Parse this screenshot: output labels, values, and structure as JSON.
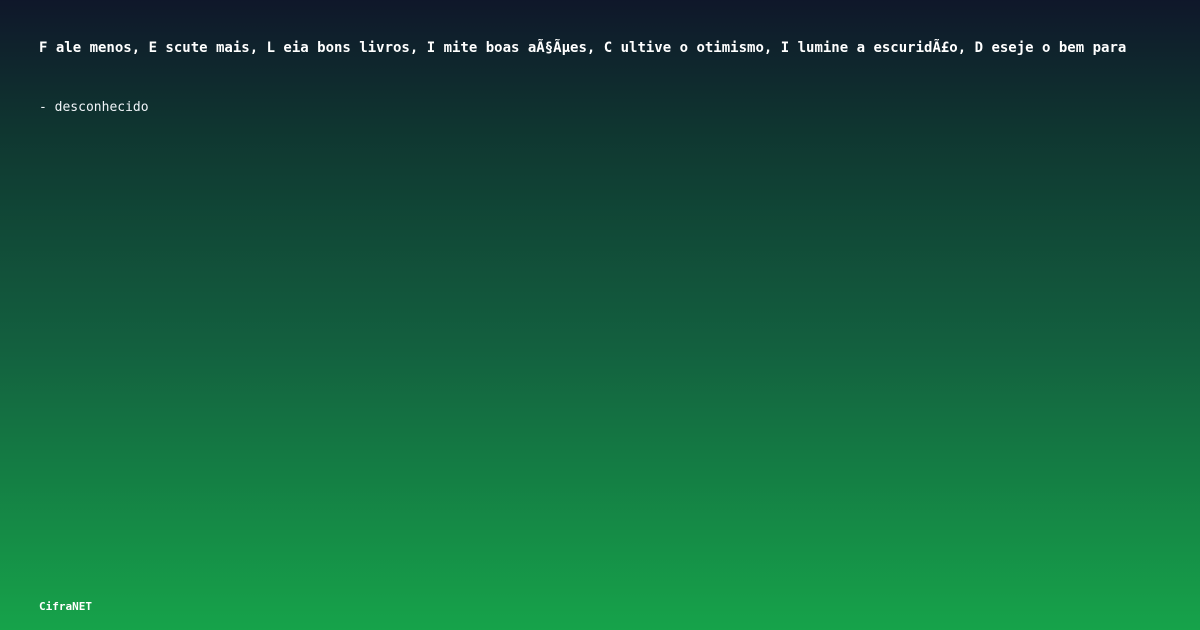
{
  "quote": {
    "text": "F ale menos, E scute mais, L eia bons livros, I mite boas aÃ§Ãµes, C ultive o otimismo, I lumine a escuridÃ£o, D eseje o bem para",
    "author": "- desconhecido"
  },
  "brand": {
    "name": "CifraNET"
  },
  "colors": {
    "gradient_top": "#0f172a",
    "gradient_bottom": "#16a34a",
    "text": "#ffffff"
  }
}
